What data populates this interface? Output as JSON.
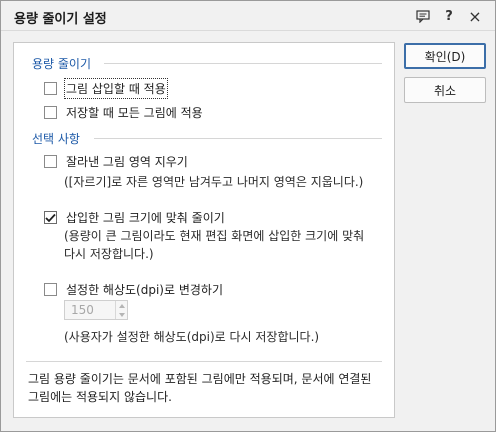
{
  "window": {
    "title": "용량 줄이기 설정"
  },
  "titlebar_icons": [
    "comment-icon",
    "help-icon",
    "close-icon"
  ],
  "titlebar_icon_glyphs": {
    "help": "?",
    "close": "×"
  },
  "section1": {
    "title": "용량 줄이기",
    "options": [
      {
        "label": "그림 삽입할 때 적용",
        "checked": false
      },
      {
        "label": "저장할 때 모든 그림에 적용",
        "checked": false
      }
    ]
  },
  "section2": {
    "title": "선택 사항",
    "crop": {
      "label": "잘라낸 그림 영역 지우기",
      "checked": false,
      "desc": "([자르기]로 자른 영역만 남겨두고 나머지 영역은 지웁니다.)"
    },
    "resize": {
      "label": "삽입한 그림 크기에 맞춰 줄이기",
      "checked": true,
      "desc_line1": "(용량이 큰 그림이라도 현재 편집 화면에 삽입한 크기에 맞춰",
      "desc_line2": "다시 저장합니다.)"
    },
    "dpi": {
      "label": "설정한 해상도(dpi)로 변경하기",
      "checked": false,
      "value": "150",
      "desc": "(사용자가 설정한 해상도(dpi)로 다시 저장합니다.)"
    }
  },
  "note_line1": "그림 용량 줄이기는 문서에 포함된 그림에만 적용되며, 문서에 연결된",
  "note_line2": "그림에는 적용되지 않습니다.",
  "buttons": {
    "ok": "확인(D)",
    "cancel": "취소"
  },
  "colors": {
    "section_title": "#1e5aa8",
    "primary_border": "#3c6ea8"
  }
}
